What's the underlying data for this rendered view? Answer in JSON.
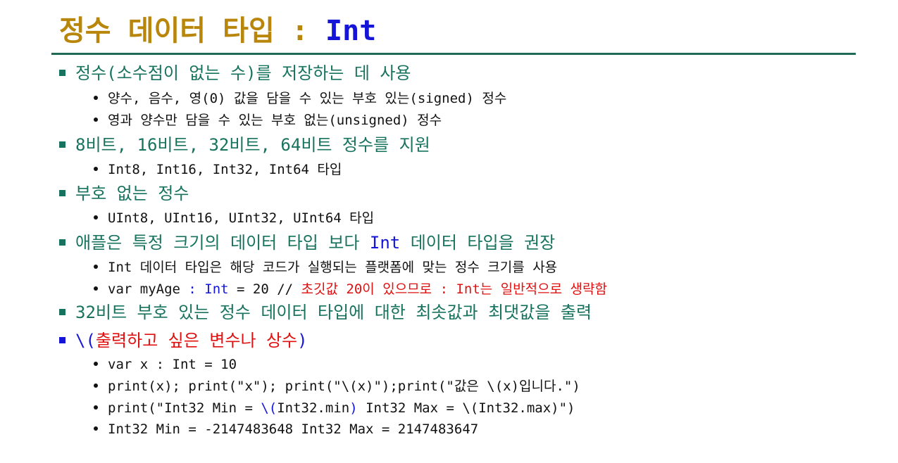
{
  "title": {
    "korean": "정수 데이터 타입",
    "separator": ":",
    "type_name": "Int"
  },
  "bullets": [
    {
      "text": "정수(소수점이 없는 수)를 저장하는 데 사용",
      "subs": [
        "양수, 음수, 영(0) 값을 담을 수 있는 부호 있는(signed) 정수",
        "영과 양수만 담을 수 있는 부호 없는(unsigned) 정수"
      ]
    },
    {
      "text": "8비트, 16비트, 32비트, 64비트 정수를 지원",
      "subs": [
        "Int8, Int16, Int32, Int64 타입"
      ]
    },
    {
      "text": "부호 없는 정수",
      "subs": [
        "UInt8, UInt16, UInt32, UInt64 타입"
      ]
    },
    {
      "text_before": "애플은 특정 크기의 데이터 타입 보다 ",
      "text_highlight": "Int",
      "text_after": " 데이터 타입을 권장",
      "subs": [
        "Int 데이터 타입은 해당 코드가 실행되는 플랫폼에 맞는 정수 크기를 사용"
      ],
      "code_example": {
        "prefix": "var myAge ",
        "type_annotation": ": Int",
        "assign": " = 20   // ",
        "comment": "초깃값 20이 있으므로 : Int는 일반적으로 생략함"
      }
    },
    {
      "text": "32비트 부호 있는 정수 데이터 타입에 대한 최솟값과 최댓값을 출력"
    },
    {
      "text_blue_open": "\\(",
      "text_red": "출력하고 싶은 변수나 상수",
      "text_blue_close": ")",
      "subs": [
        "var x : Int = 10",
        "print(x); print(\"x\"); print(\"\\(x)\");print(\"값은 \\(x)입니다.\")"
      ],
      "interp_example": {
        "part1": "print(\"Int32 Min = ",
        "interp_open": "\\(",
        "interp_inner": "Int32.min",
        "interp_close": ")",
        "part2": " Int32 Max = \\(Int32.max)\")"
      },
      "output": "Int32 Min = -2147483648 Int32 Max = 2147483647"
    }
  ],
  "colors": {
    "title_gold": "#b8860b",
    "title_blue": "#1515d8",
    "heading_green": "#17735e",
    "rule_green": "#1f6b55",
    "highlight_red": "#e01010"
  }
}
